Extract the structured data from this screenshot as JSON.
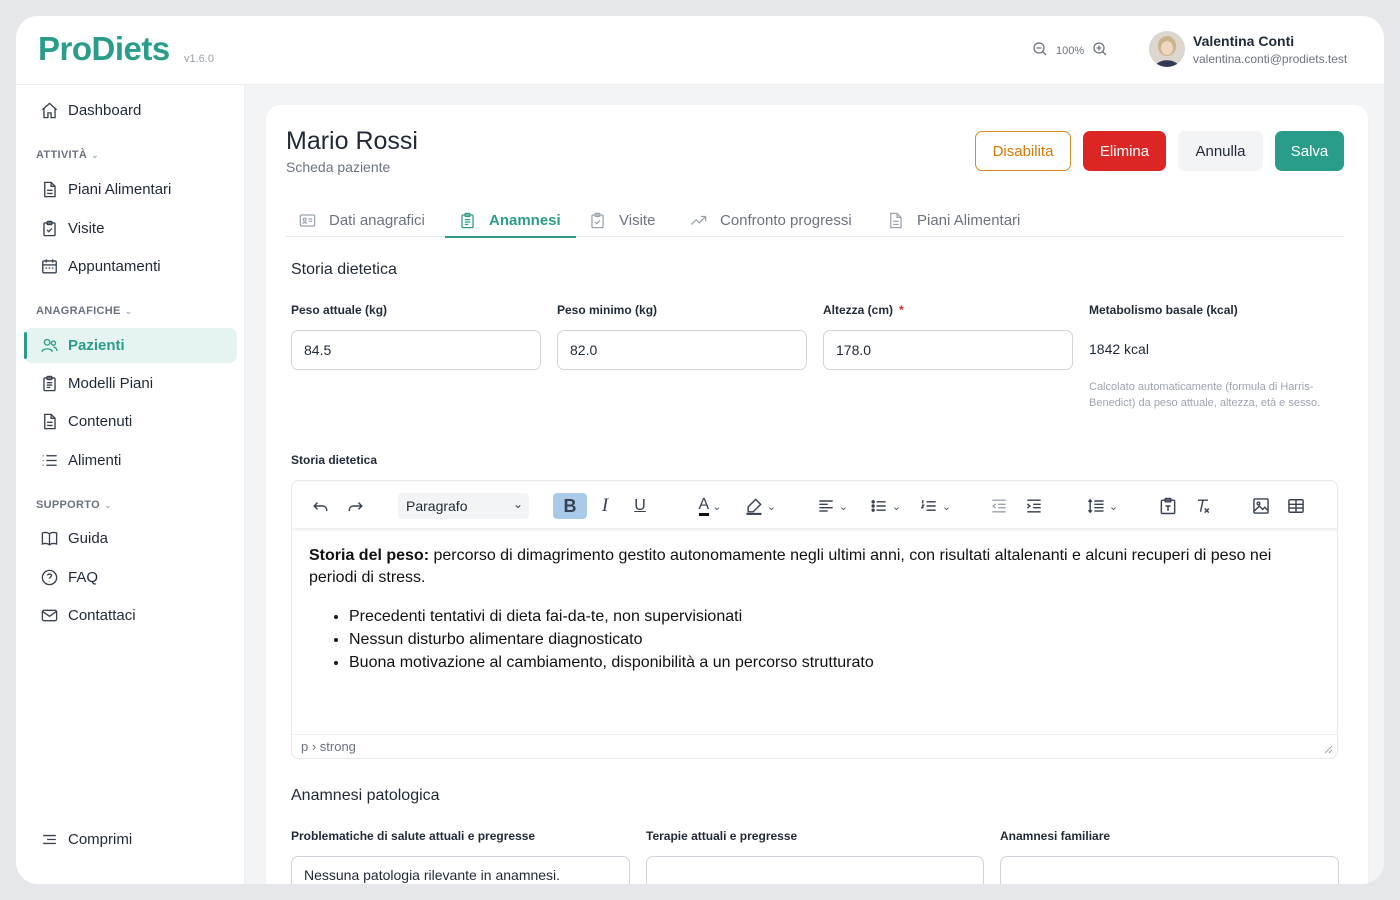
{
  "app": {
    "name": "ProDiets",
    "version": "v1.6.0"
  },
  "header": {
    "zoom": "100%",
    "user_name": "Valentina Conti",
    "user_email": "valentina.conti@prodiets.test"
  },
  "sidebar": {
    "dashboard": "Dashboard",
    "sections": [
      {
        "title": "ATTIVITÀ",
        "items": [
          "Piani Alimentari",
          "Visite",
          "Appuntamenti"
        ]
      },
      {
        "title": "ANAGRAFICHE",
        "items": [
          "Pazienti",
          "Modelli Piani",
          "Contenuti",
          "Alimenti"
        ]
      },
      {
        "title": "SUPPORTO",
        "items": [
          "Guida",
          "FAQ",
          "Contattaci"
        ]
      }
    ],
    "active_item": "Pazienti",
    "collapse_label": "Comprimi"
  },
  "page": {
    "title": "Mario Rossi",
    "subtitle": "Scheda paziente",
    "buttons": {
      "disable": "Disabilita",
      "delete": "Elimina",
      "cancel": "Annulla",
      "save": "Salva"
    },
    "tabs": [
      "Dati anagrafici",
      "Anamnesi",
      "Visite",
      "Confronto progressi",
      "Piani Alimentari"
    ],
    "active_tab": "Anamnesi"
  },
  "diet_history": {
    "section_title": "Storia dietetica",
    "fields": {
      "peso_attuale": {
        "label": "Peso attuale (kg)",
        "value": "84.5"
      },
      "peso_minimo": {
        "label": "Peso minimo (kg)",
        "value": "82.0"
      },
      "altezza": {
        "label": "Altezza (cm)",
        "required_mark": "*",
        "value": "178.0"
      },
      "metabolismo": {
        "label": "Metabolismo basale (kcal)",
        "value": "1842 kcal",
        "hint": "Calcolato automaticamente (formula di Harris-Benedict) da peso attuale, altezza, età e sesso."
      }
    },
    "editor_label": "Storia dietetica",
    "editor": {
      "block_format": "Paragrafo",
      "intro_bold": "Storia del peso:",
      "intro_text": " percorso di dimagrimento gestito autonomamente negli ultimi anni, con risultati altalenanti e alcuni recuperi di peso nei periodi di stress.",
      "bullets": [
        "Precedenti tentativi di dieta fai-da-te, non supervisionati",
        "Nessun disturbo alimentare diagnosticato",
        "Buona motivazione al cambiamento, disponibilità a un percorso strutturato"
      ],
      "status_path": "p › strong"
    }
  },
  "pathology": {
    "section_title": "Anamnesi patologica",
    "fields": [
      {
        "label": "Problematiche di salute attuali e pregresse",
        "value": "Nessuna patologia rilevante in anamnesi."
      },
      {
        "label": "Terapie attuali e pregresse",
        "value": ""
      },
      {
        "label": "Anamnesi familiare",
        "value": ""
      }
    ]
  }
}
